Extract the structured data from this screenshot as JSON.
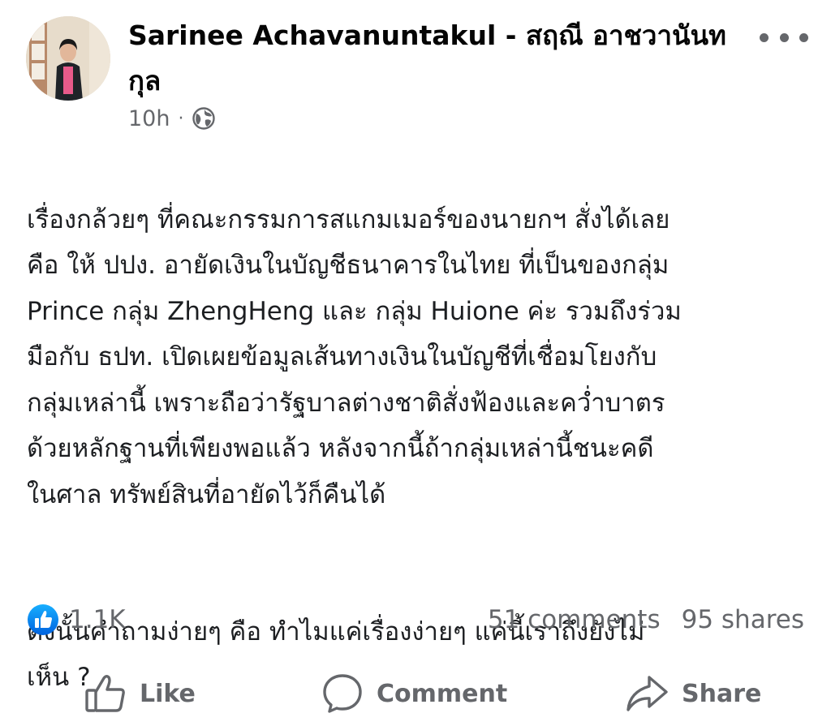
{
  "post": {
    "author_name": "Sarinee Achavanuntakul - สฤณี อาชวานันทกุล",
    "timestamp": "10h",
    "separator": "·",
    "audience_icon": "globe-icon",
    "more_icon": "more-horizontal-icon",
    "body_paragraphs": [
      "เรื่องกล้วยๆ ที่คณะกรรมการสแกมเมอร์ของนายกฯ สั่งได้เลย\nคือ ให้ ปปง. อายัดเงินในบัญชีธนาคารในไทย ที่เป็นของกลุ่ม\nPrince กลุ่ม ZhengHeng และ กลุ่ม Huione ค่ะ รวมถึงร่วม\nมือกับ ธปท. เปิดเผยข้อมูลเส้นทางเงินในบัญชีที่เชื่อมโยงกับ\nกลุ่มเหล่านี้ เพราะถือว่ารัฐบาลต่างชาติสั่งฟ้องและคว่ำบาตร\nด้วยหลักฐานที่เพียงพอแล้ว หลังจากนี้ถ้ากลุ่มเหล่านี้ชนะคดี\nในศาล ทรัพย์สินที่อายัดไว้ก็คืนได้",
      "ดังนั้นคำถามง่ายๆ คือ ทำไมแค่เรื่องง่ายๆ แค่นี้เราถึงยังไม่\nเห็น ?"
    ]
  },
  "stats": {
    "reaction_icon": "like-reaction-icon",
    "reaction_count": "1.1K",
    "comments": "51 comments",
    "shares": "95 shares"
  },
  "actions": {
    "like": {
      "label": "Like",
      "icon": "thumbs-up-icon"
    },
    "comment": {
      "label": "Comment",
      "icon": "comment-bubble-icon"
    },
    "share": {
      "label": "Share",
      "icon": "share-arrow-icon"
    }
  },
  "colors": {
    "accent_blue": "#1b74e4",
    "secondary_text": "#65676b",
    "primary_text": "#1c1e21",
    "avatar_shirt": "#e85a8a",
    "avatar_jacket": "#1f2328"
  }
}
